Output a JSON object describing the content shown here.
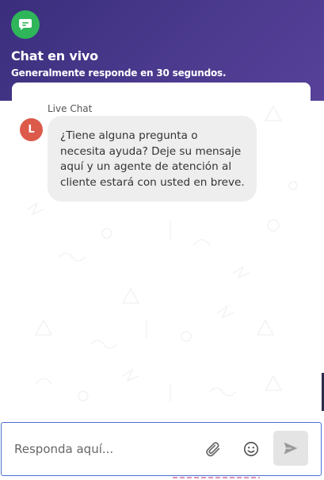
{
  "header": {
    "title": "Chat en vivo",
    "subtitle": "Generalmente responde en 30 segundos.",
    "logo_icon": "chat-bubble-icon",
    "brand_color": "#2fb65a",
    "background_color": "#4b3a8e"
  },
  "conversation": {
    "sender_name": "Live Chat",
    "avatar_initial": "L",
    "avatar_color": "#dc5a4a",
    "message": "¿Tiene alguna pregunta o necesita ayuda? Deje su mensaje aquí y un agente de atención al cliente estará con usted en breve."
  },
  "composer": {
    "placeholder": "Responda aquí...",
    "value": "",
    "attach_icon": "paperclip-icon",
    "emoji_icon": "smiley-icon",
    "send_icon": "send-icon",
    "focus_color": "#4a6fd0"
  }
}
